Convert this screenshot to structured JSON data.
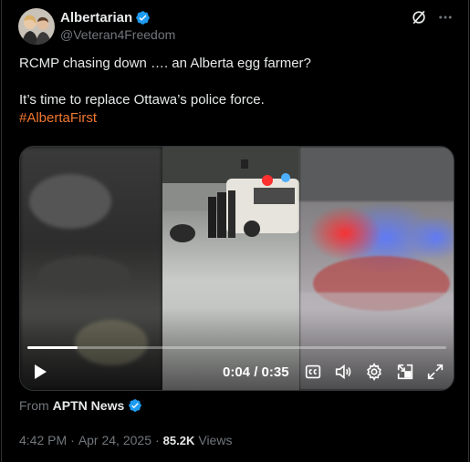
{
  "author": {
    "display_name": "Albertarian",
    "handle": "@Veteran4Freedom"
  },
  "post": {
    "line1": "RCMP chasing down …. an Alberta egg farmer?",
    "line2": "It’s time to replace Ottawa’s police force.",
    "hashtag": "#AlbertaFirst"
  },
  "video": {
    "time_display": "0:04 / 0:35",
    "progress_fraction": 0.12
  },
  "source": {
    "from_label": "From",
    "name": "APTN News"
  },
  "meta": {
    "time": "4:42 PM",
    "dot1": "·",
    "date": "Apr 24, 2025",
    "dot2": "·",
    "views_count": "85.2K",
    "views_label": "Views"
  },
  "icons": {
    "verified": "verified-badge-icon",
    "grok": "grok-icon",
    "more": "more-options-icon",
    "play": "play-icon",
    "captions": "captions-icon",
    "volume": "volume-icon",
    "settings": "settings-icon",
    "pip": "picture-in-picture-icon",
    "fullscreen": "fullscreen-icon"
  },
  "colors": {
    "accent": "#1d9bf0",
    "hashtag": "#f0762f",
    "muted": "#71767b",
    "text": "#e7e9ea"
  }
}
